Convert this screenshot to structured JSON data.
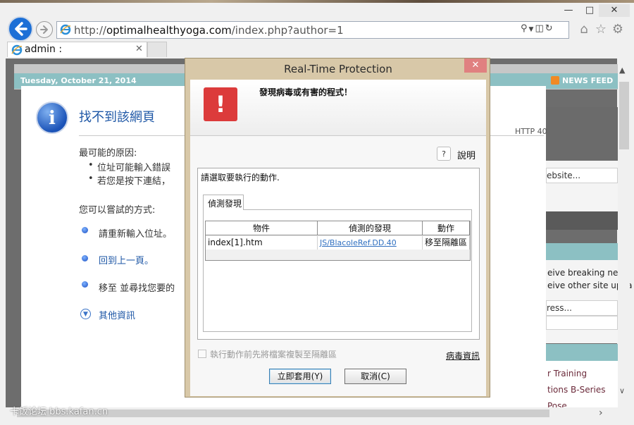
{
  "browser": {
    "address_prefix": "http://",
    "address_host": "optimalhealthyoga.com",
    "address_path": "/index.php?author=1",
    "tab_label": "admin :"
  },
  "site": {
    "date": "Tuesday, October 21, 2014",
    "news_feed": "NEWS FEED",
    "side_website": "ebsite...",
    "side_breaking": "eive breaking news",
    "side_other": "eive other site upda",
    "side_address": "ress...",
    "side_links": [
      "r Training",
      "tions B-Series",
      "Pose"
    ]
  },
  "error_page": {
    "title": "找不到該網頁",
    "http_code": "HTTP 40",
    "causes_heading": "最可能的原因:",
    "causes": [
      "位址可能輸入錯誤",
      "若您是按下連結，"
    ],
    "try_heading": "您可以嘗試的方式:",
    "options": [
      "請重新輸入位址。",
      "回到上一頁。",
      "移至  並尋找您要的"
    ],
    "more_info": "其他資訊"
  },
  "dialog": {
    "title": "Real-Time Protection",
    "headline": "發現病毒或有害的程式！",
    "help_label": "說明",
    "prompt": "請選取要執行的動作.",
    "tab_label": "偵測發現",
    "columns": [
      "物件",
      "偵測的發現",
      "動作"
    ],
    "rows": [
      {
        "object": "index[1].htm",
        "detection": "JS/BlacoleRef.DD.40",
        "action": "移至隔離區"
      }
    ],
    "copy_checkbox_label": "執行動作前先將檔案複製至隔離區",
    "copy_checked": false,
    "virus_info": "病毒資訊",
    "apply_button": "立即套用(Y)",
    "cancel_button": "取消(C)"
  },
  "watermark": "卡饭论坛 bbs.kafan.cn",
  "colors": {
    "warning_red": "#dc3b3b",
    "teal_bar": "#8cc0c3",
    "link_blue": "#1e57a6",
    "ie_back_blue": "#1c6fd6"
  },
  "icons": [
    "back-icon",
    "forward-icon",
    "ie-icon",
    "search-icon",
    "compat-icon",
    "refresh-icon",
    "home-icon",
    "favorites-icon",
    "settings-icon",
    "info-icon",
    "warning-icon",
    "help-icon",
    "rss-icon"
  ]
}
